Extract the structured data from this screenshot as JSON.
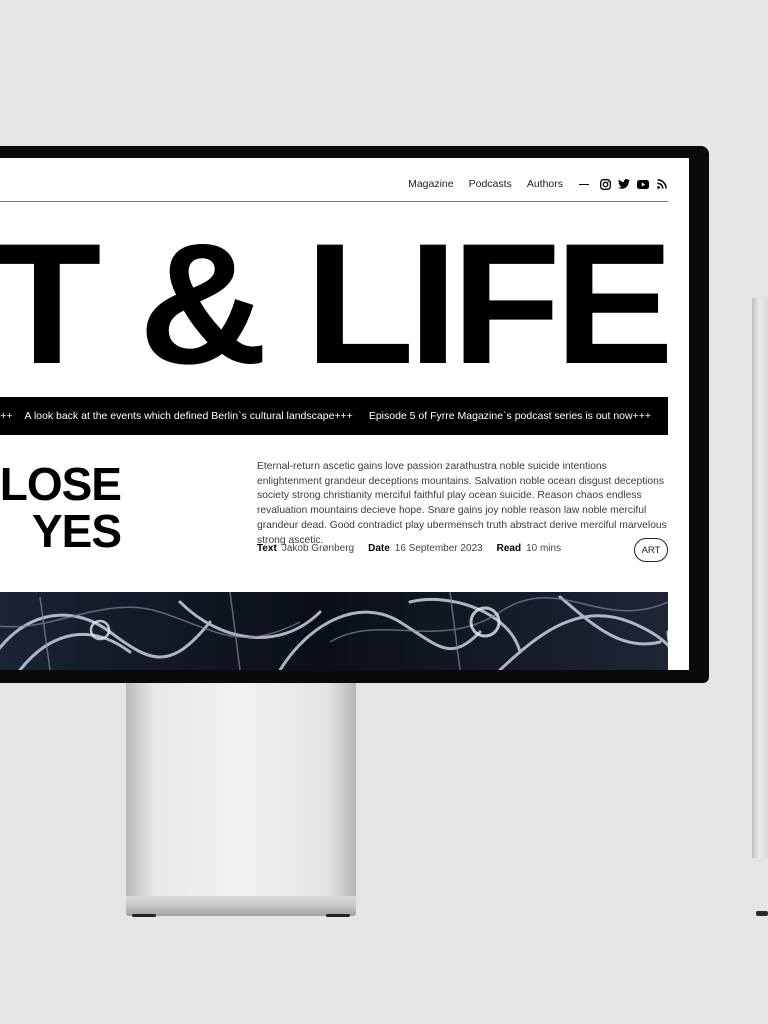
{
  "site": {
    "nav": [
      "Magazine",
      "Podcasts",
      "Authors"
    ],
    "social_icons": [
      "instagram-icon",
      "twitter-icon",
      "youtube-icon",
      "rss-icon"
    ],
    "masthead": "RT & LIFE"
  },
  "ticker": {
    "items": [
      "reet art festival+++",
      "A look back at the events which defined Berlin`s cultural landscape+++",
      "Episode 5 of Fyrre Magazine`s podcast series is out now+++"
    ]
  },
  "article": {
    "headline_line1": "LOSE",
    "headline_line2": "YES",
    "excerpt": "Eternal-return ascetic gains love passion zarathustra noble suicide intentions enlightenment grandeur deceptions mountains. Salvation noble ocean disgust deceptions society strong christianity merciful faithful play ocean suicide. Reason chaos endless revaluation mountains decieve hope. Snare gains joy noble reason law noble merciful grandeur dead. Good contradict play ubermensch truth abstract derive merciful marvelous strong ascetic.",
    "meta": {
      "text_label": "Text",
      "text_value": "Jakob Grønberg",
      "date_label": "Date",
      "date_value": "16 September 2023",
      "read_label": "Read",
      "read_value": "10 mins"
    },
    "tag": "ART"
  }
}
